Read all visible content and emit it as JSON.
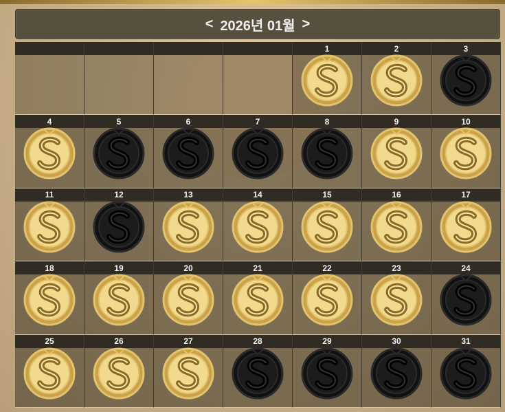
{
  "calendar": {
    "prev_label": "<",
    "title": "2026년 01월",
    "next_label": ">",
    "leading_empty_cells": 4,
    "days": [
      {
        "day": "1",
        "status": "gold"
      },
      {
        "day": "2",
        "status": "gold"
      },
      {
        "day": "3",
        "status": "black"
      },
      {
        "day": "4",
        "status": "gold"
      },
      {
        "day": "5",
        "status": "black"
      },
      {
        "day": "6",
        "status": "black"
      },
      {
        "day": "7",
        "status": "black"
      },
      {
        "day": "8",
        "status": "black"
      },
      {
        "day": "9",
        "status": "gold"
      },
      {
        "day": "10",
        "status": "gold"
      },
      {
        "day": "11",
        "status": "gold"
      },
      {
        "day": "12",
        "status": "black"
      },
      {
        "day": "13",
        "status": "gold"
      },
      {
        "day": "14",
        "status": "gold"
      },
      {
        "day": "15",
        "status": "gold"
      },
      {
        "day": "16",
        "status": "gold"
      },
      {
        "day": "17",
        "status": "gold"
      },
      {
        "day": "18",
        "status": "gold"
      },
      {
        "day": "19",
        "status": "gold"
      },
      {
        "day": "20",
        "status": "gold"
      },
      {
        "day": "21",
        "status": "gold"
      },
      {
        "day": "22",
        "status": "gold"
      },
      {
        "day": "23",
        "status": "gold"
      },
      {
        "day": "24",
        "status": "black"
      },
      {
        "day": "25",
        "status": "gold"
      },
      {
        "day": "26",
        "status": "gold"
      },
      {
        "day": "27",
        "status": "gold"
      },
      {
        "day": "28",
        "status": "black"
      },
      {
        "day": "29",
        "status": "black"
      },
      {
        "day": "30",
        "status": "black"
      },
      {
        "day": "31",
        "status": "black"
      }
    ],
    "stamp_icon": "s-coin-icon",
    "colors": {
      "gold": "#e3c36b",
      "gold_dark": "#8a6a24",
      "black": "#111111",
      "black_ring": "#2a2a2a"
    }
  }
}
